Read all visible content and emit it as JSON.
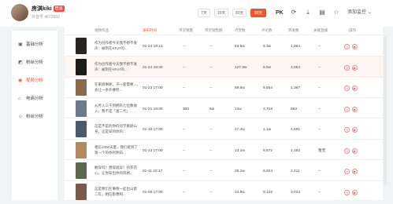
{
  "user": {
    "name": "房淇kiki",
    "badge": "已认",
    "id": "抖音号 4672592"
  },
  "ranges": [
    {
      "label": "7天",
      "active": false
    },
    {
      "label": "15天",
      "active": false
    },
    {
      "label": "30天",
      "active": false
    },
    {
      "label": "90天",
      "active": true
    }
  ],
  "toolbar": {
    "pk": "PK",
    "add_monitor": "添加监控"
  },
  "sidebar": {
    "items": [
      {
        "label": "基础分析",
        "icon": "▣",
        "active": false
      },
      {
        "label": "粉丝分析",
        "icon": "◩",
        "active": false
      },
      {
        "label": "视频分析",
        "icon": "◉",
        "active": true
      },
      {
        "label": "电商分析",
        "icon": "⌂",
        "active": false
      },
      {
        "label": "粉丝分析",
        "icon": "☺",
        "active": false
      }
    ]
  },
  "table": {
    "headers": [
      "视频作品",
      "发布时间",
      "带货销量",
      "带货销售额",
      "点赞数",
      "评论数",
      "转发数",
      "关联直播",
      "操作"
    ],
    "rows": [
      {
        "title": "作为创作者今天我不想不发声：被刻在KP.e*的...",
        "time": "01-24 19:13",
        "sales": "--",
        "gmv": "--",
        "likes": "53.6w",
        "comments": "5.3w",
        "shares": "1,964",
        "live": "--",
        "color": "#2a2420",
        "hl": false
      },
      {
        "title": "作为创作者今天我不想不发声：被刻在KP.e*的...",
        "time": "01-24 18:30",
        "sales": "--",
        "gmv": "--",
        "likes": "127.9w",
        "comments": "6.5w",
        "shares": "4,054",
        "live": "--",
        "color": "#1e1a18",
        "hl": true
      },
      {
        "title": "在家搞事呢，于一套需要...，会让一条外婆所...",
        "time": "01-23 17:00",
        "sales": "--",
        "gmv": "--",
        "likes": "59.6w",
        "comments": "6,554",
        "shares": "1,367",
        "live": "--",
        "color": "#8a6a4a",
        "hl": false
      },
      {
        "title": "从月入三千到拥有七位数收入，我不是「富二代」...",
        "time": "01-21 19:00",
        "sales": "300",
        "gmv": "6w",
        "likes": "14w",
        "comments": "2,719",
        "shares": "663",
        "live": "--",
        "color": "#6a7c8a",
        "hl": false
      },
      {
        "title": "这是不是的你的同学素颜山身，这是穿的你的...",
        "time": "01-18 17:00",
        "sales": "--",
        "gmv": "--",
        "likes": "17.4w",
        "comments": "1.1w",
        "shares": "4,591",
        "live": "--",
        "color": "#4a5a6a",
        "hl": false
      },
      {
        "title": "相信1000天量，我们挺到了第一个的你的明白...",
        "time": "01-13 17:00",
        "sales": "--",
        "gmv": "--",
        "likes": "13.1w",
        "comments": "6,672",
        "shares": "1,182",
        "live": "暂无",
        "color": "#b08a5a",
        "hl": false
      },
      {
        "title": "敢穿吗？想穿就穿！的衣花心，让你穿出你的风格...",
        "time": "01-11 22:17",
        "sales": "--",
        "gmv": "--",
        "likes": "26.1w",
        "comments": "6,924",
        "shares": "2,411",
        "live": "--",
        "color": "#5a6a4a",
        "hl": false
      },
      {
        "title": "这是我们在事情一起出山第二年，相信影像和...",
        "time": "01-08 17:00",
        "sales": "--",
        "gmv": "--",
        "likes": "14.8w",
        "comments": "9,132",
        "shares": "3,014",
        "live": "--",
        "color": "#7a5a4a",
        "hl": false
      }
    ]
  },
  "colors": {
    "accent": "#f3542c"
  }
}
